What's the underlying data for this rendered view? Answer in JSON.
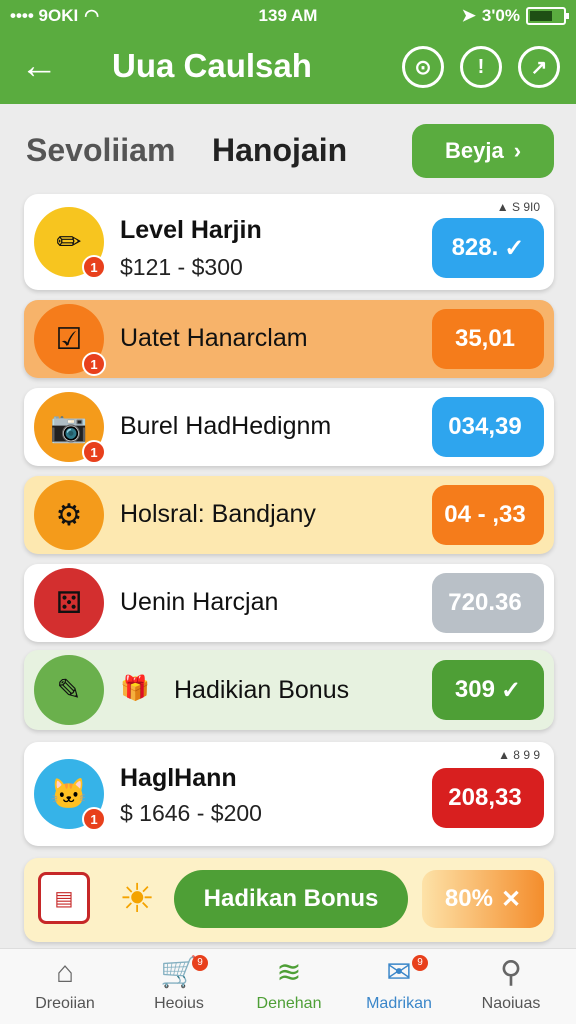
{
  "status_bar": {
    "carrier": "•••• 9OKI",
    "time": "139 AM",
    "battery": "3'0%"
  },
  "header": {
    "title": "Uua Caulsah"
  },
  "section": {
    "left_label": "Sevoliiam",
    "right_label": "Hanojain",
    "button_label": "Beyja"
  },
  "rows": [
    {
      "title": "Level Harjin",
      "subtitle": "$121 - $300",
      "tag": "▲ S 9I0",
      "value": "828.",
      "value_mark": "✓",
      "value_color": "#2ea5ee",
      "bg": "#ffffff",
      "icon": "✏",
      "icon_bg": "#f7c51f",
      "badge": "1"
    },
    {
      "title": "Uatet Hanarclam",
      "value": "35,01",
      "value_color": "#f57c1b",
      "bg": "#f7b36a",
      "icon": "☑",
      "icon_bg": "#f57c1b",
      "badge": "1"
    },
    {
      "title": "Burel HadHedignm",
      "value": "034,39",
      "value_color": "#2ea5ee",
      "bg": "#ffffff",
      "icon": "📷",
      "icon_bg": "#f49b1b",
      "badge": "1"
    },
    {
      "title": "Holsral: Bandjany",
      "value": "04 - ,33",
      "value_color": "#f57c1b",
      "bg": "#fde8b0",
      "icon": "⚙",
      "icon_bg": "#f49b1b",
      "badge": ""
    },
    {
      "title": "Uenin Harcjan",
      "value": "720.36",
      "value_color": "#b9c0c7",
      "bg": "#ffffff",
      "icon": "⚄",
      "icon_bg": "#d32f2f",
      "badge": ""
    },
    {
      "title": "Hadikian Bonus",
      "value": "309",
      "value_mark": "✓",
      "value_color": "#4e9f36",
      "bg": "#e7f2e0",
      "icon": "✎",
      "icon_bg": "#6ab04c",
      "badge": ""
    },
    {
      "title": "HaglHann",
      "subtitle": "$ 1646 - $200",
      "tag": "▲ 8 9 9",
      "value": "208,33",
      "value_color": "#d81f1f",
      "bg": "#ffffff",
      "icon": "🐱",
      "icon_bg": "#36b3e8",
      "badge": "1"
    }
  ],
  "bonus": {
    "calendar_icon": "calendar-icon",
    "button_label": "Hadikan Bonus",
    "percent": "80%",
    "close": "✕"
  },
  "nav": [
    {
      "label": "Dreoiian",
      "icon": "⌂"
    },
    {
      "label": "Heoius",
      "icon": "🛒",
      "badge": "9"
    },
    {
      "label": "Denehan",
      "icon": "≋"
    },
    {
      "label": "Madrikan",
      "icon": "✉",
      "badge": "9"
    },
    {
      "label": "Naoiuas",
      "icon": "⚲"
    }
  ]
}
